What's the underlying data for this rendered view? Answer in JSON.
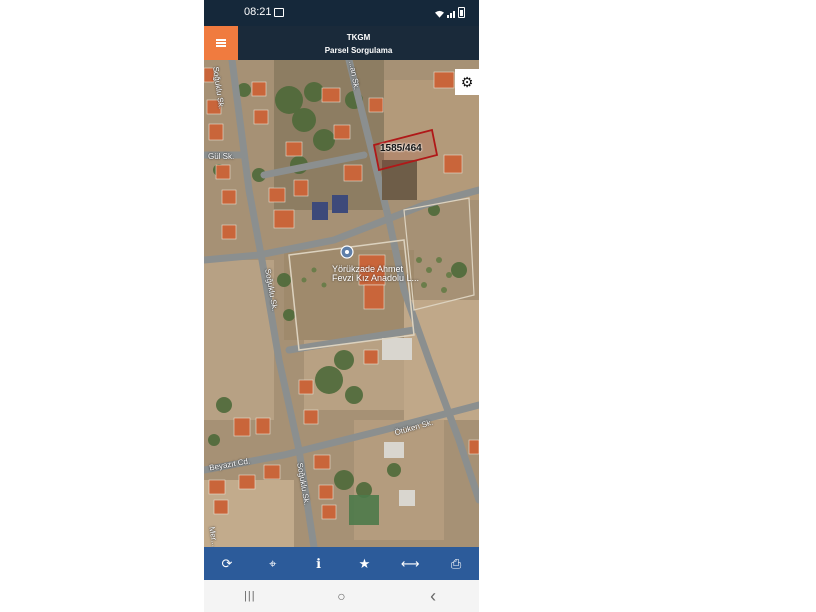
{
  "status_bar": {
    "time": "08:21"
  },
  "header": {
    "title": "TKGM",
    "subtitle": "Parsel Sorgulama"
  },
  "map": {
    "parcel_label": "1585/464",
    "poi_label_line1": "Yörükzade Ahmet",
    "poi_label_line2": "Fevzi Kız Anadolu L...",
    "streets": {
      "a": "Soğuklu Sk.",
      "b": "Gül Sk.",
      "c": "Soğuklu Sk.",
      "d": "Ötüken Sk.",
      "e": "Beyazıt Cd.",
      "f": "Soğuklu Sk.",
      "g": "Mer...",
      "h": "...an Sk."
    }
  },
  "toolbar": {
    "items": [
      {
        "name": "refresh-icon",
        "glyph": "⟳"
      },
      {
        "name": "locate-icon",
        "glyph": "⌖"
      },
      {
        "name": "info-icon",
        "glyph": "ℹ"
      },
      {
        "name": "favorite-star-icon",
        "glyph": "★"
      },
      {
        "name": "measure-icon",
        "glyph": "⟷"
      },
      {
        "name": "print-icon",
        "glyph": "⎙"
      }
    ]
  },
  "nav_bar": {
    "recent": "|||",
    "home": "○",
    "back": "‹"
  },
  "colors": {
    "accent": "#f07b3f",
    "header": "#1a2a3a",
    "toolbar": "#2c5b9a",
    "parcel_outline": "#b01818"
  }
}
